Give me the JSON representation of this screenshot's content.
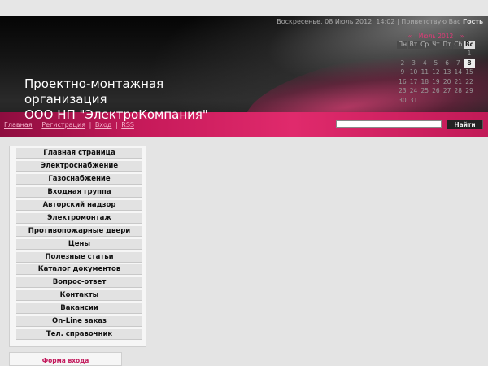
{
  "header": {
    "date": "Воскресенье, 08 Июль 2012, 14:02",
    "separator": "|",
    "greeting": "Приветствую Вас",
    "user": "Гость",
    "title_line1": "Проектно-монтажная",
    "title_line2": "организация",
    "title_line3": "ООО НП \"ЭлектроКомпания\""
  },
  "calendar": {
    "prev": "«",
    "month": "Июль 2012",
    "next": "»",
    "days": [
      "Пн",
      "Вт",
      "Ср",
      "Чт",
      "Пт",
      "Сб",
      "Вс"
    ],
    "weeks": [
      [
        "",
        "",
        "",
        "",
        "",
        "",
        "1"
      ],
      [
        "2",
        "3",
        "4",
        "5",
        "6",
        "7",
        "8"
      ],
      [
        "9",
        "10",
        "11",
        "12",
        "13",
        "14",
        "15"
      ],
      [
        "16",
        "17",
        "18",
        "19",
        "20",
        "21",
        "22"
      ],
      [
        "23",
        "24",
        "25",
        "26",
        "27",
        "28",
        "29"
      ],
      [
        "30",
        "31",
        "",
        "",
        "",
        "",
        ""
      ]
    ],
    "today": "8"
  },
  "nav": {
    "home": "Главная",
    "register": "Регистрация",
    "login": "Вход",
    "rss": "RSS",
    "sep": "|"
  },
  "search": {
    "button": "Найти",
    "placeholder": ""
  },
  "menu": {
    "items": [
      "Главная страница",
      "Электроснабжение",
      "Газоснабжение",
      "Входная группа",
      "Авторский надзор",
      "Электромонтаж",
      "Противопожарные двери",
      "Цены",
      "Полезные статьи",
      "Каталог документов",
      "Вопрос-ответ",
      "Контакты",
      "Вакансии",
      "On-Line заказ",
      "Тел. справочник"
    ]
  },
  "login_form": {
    "title": "Форма входа"
  },
  "colors": {
    "accent": "#e02a6c",
    "header_dark": "#0a0a0a",
    "page_bg": "#e4e4e4"
  }
}
